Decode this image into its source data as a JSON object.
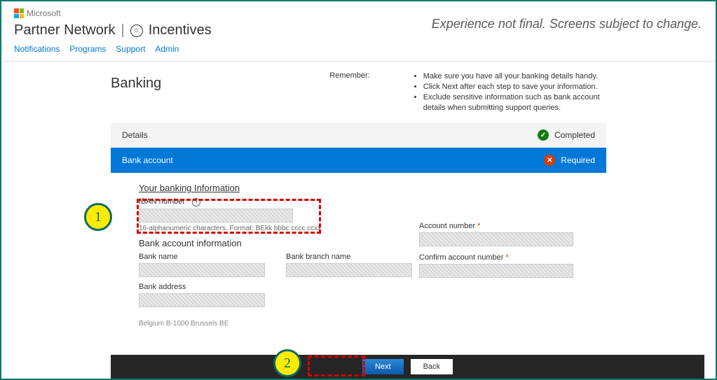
{
  "brand": "Microsoft",
  "crumb": {
    "partner_network": "Partner Network",
    "incentives": "Incentives"
  },
  "nav": {
    "notifications": "Notifications",
    "programs": "Programs",
    "support": "Support",
    "admin": "Admin"
  },
  "disclaimer": "Experience not final. Screens subject to change.",
  "page_title": "Banking",
  "remember": {
    "label": "Remember:",
    "items": [
      "Make sure you have all your banking details handy.",
      "Click Next after each step to save your information.",
      "Exclude sensitive information such as bank account details when submitting support queries."
    ]
  },
  "sections": {
    "details": {
      "label": "Details",
      "status": "Completed"
    },
    "bank": {
      "label": "Bank account",
      "status": "Required"
    }
  },
  "form": {
    "your_banking_info": "Your banking Information",
    "iban_label": "IBAN number",
    "iban_hint": "16-alphanumeric characters. Format: BEkk bbbc cccc ccxx",
    "bank_acct_info": "Bank account information",
    "bank_name": "Bank name",
    "branch_name": "Bank branch name",
    "bank_address": "Bank address",
    "address_value": "Belgium  B-1000 Brussels BE",
    "account_number": "Account number",
    "confirm_account_number": "Confirm account number"
  },
  "buttons": {
    "next": "Next",
    "back": "Back"
  },
  "callouts": {
    "one": "1",
    "two": "2"
  }
}
